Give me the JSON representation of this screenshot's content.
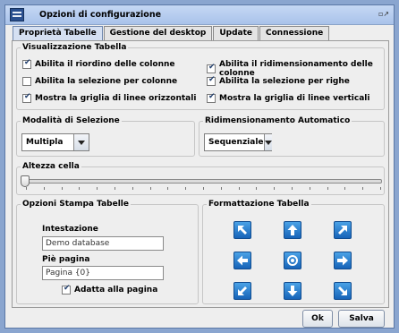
{
  "window": {
    "title": "Opzioni di configurazione",
    "control_icon": "restore-icon"
  },
  "tabs": [
    {
      "label": "Proprietà Tabelle",
      "active": true
    },
    {
      "label": "Gestione del desktop",
      "active": false
    },
    {
      "label": "Update",
      "active": false
    },
    {
      "label": "Connessione",
      "active": false
    }
  ],
  "visualizzazione": {
    "title": "Visualizzazione Tabella",
    "options": [
      {
        "label": "Abilita il riordino delle colonne",
        "checked": true
      },
      {
        "label": "Abilita il ridimensionamento delle colonne",
        "checked": true
      },
      {
        "label": "Abilita la selezione per colonne",
        "checked": false
      },
      {
        "label": "Abilita la selezione per righe",
        "checked": true
      },
      {
        "label": "Mostra la griglia di linee orizzontali",
        "checked": true
      },
      {
        "label": "Mostra la griglia di linee verticali",
        "checked": true
      }
    ]
  },
  "selezione": {
    "title": "Modalità di Selezione",
    "value": "Multipla"
  },
  "ridimensionamento": {
    "title": "Ridimensionamento Automatico",
    "value": "Sequenziale"
  },
  "altezza": {
    "title": "Altezza cella",
    "level": 0
  },
  "stampa": {
    "title": "Opzioni Stampa Tabelle",
    "header_label": "Intestazione",
    "header_value": "Demo database",
    "footer_label": "Piè pagina",
    "footer_value": "Pagina {0}",
    "fit_label": "Adatta alla pagina",
    "fit_checked": true
  },
  "formattazione": {
    "title": "Formattazione Tabella",
    "buttons": [
      "arrow-up-left-icon",
      "arrow-up-icon",
      "arrow-up-right-icon",
      "arrow-left-icon",
      "center-icon",
      "arrow-right-icon",
      "arrow-down-left-icon",
      "arrow-down-icon",
      "arrow-down-right-icon"
    ]
  },
  "footer": {
    "ok_label": "Ok",
    "save_label": "Salva"
  },
  "colors": {
    "accent": "#1663b8",
    "window_bg": "#eeeeee",
    "title_bar": "#b5cdee"
  }
}
